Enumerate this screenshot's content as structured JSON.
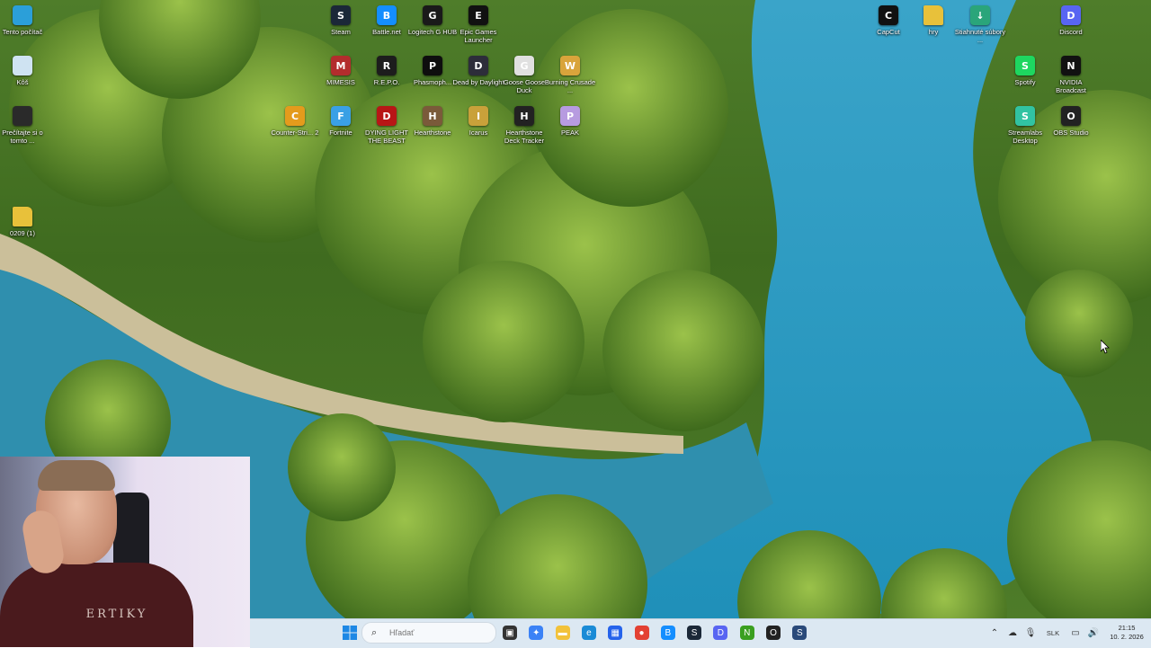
{
  "desktop": {
    "left_column": [
      {
        "label": "Tento počítač",
        "icon": "monitor-icon",
        "color": "#2b9fd9"
      },
      {
        "label": "Kôš",
        "icon": "recycle-bin-icon",
        "color": "#cfe3f2"
      },
      {
        "label": "Prečítajte si o tomto ...",
        "icon": "info-icon",
        "color": "#2a2a2a"
      },
      {
        "label": "0209 (1)",
        "icon": "folder-icon",
        "color": "#e8c13a"
      }
    ],
    "row1": [
      {
        "label": "Steam",
        "icon": "steam-icon",
        "color": "#1b2838",
        "glyph": "S"
      },
      {
        "label": "Battle.net",
        "icon": "battlenet-icon",
        "color": "#148eff",
        "glyph": "B"
      },
      {
        "label": "Logitech G HUB",
        "icon": "logitech-icon",
        "color": "#1a1a1a",
        "glyph": "G"
      },
      {
        "label": "Epic Games Launcher",
        "icon": "epic-games-icon",
        "color": "#111111",
        "glyph": "E"
      }
    ],
    "row2": [
      {
        "label": "MIMESIS",
        "icon": "mimesis-icon",
        "color": "#b32d2d",
        "glyph": "M"
      },
      {
        "label": "R.E.P.O.",
        "icon": "repo-icon",
        "color": "#1d1d1d",
        "glyph": "R"
      },
      {
        "label": "Phasmoph...",
        "icon": "phasmophobia-icon",
        "color": "#0e0e0e",
        "glyph": "P"
      },
      {
        "label": "Dead by Daylight",
        "icon": "dead-by-daylight-icon",
        "color": "#2d2d3a",
        "glyph": "D"
      },
      {
        "label": "Goose Goose Duck",
        "icon": "goose-goose-duck-icon",
        "color": "#e0e0e0",
        "glyph": "G"
      },
      {
        "label": "Burning Crusade ...",
        "icon": "wow-icon",
        "color": "#d9a43b",
        "glyph": "W"
      }
    ],
    "row3": [
      {
        "label": "Counter-Stri... 2",
        "icon": "counter-strike-icon",
        "color": "#e49b1c",
        "glyph": "C"
      },
      {
        "label": "Fortnite",
        "icon": "fortnite-icon",
        "color": "#3aa0e5",
        "glyph": "F"
      },
      {
        "label": "DYING LIGHT THE BEAST",
        "icon": "dying-light-icon",
        "color": "#b81616",
        "glyph": "D"
      },
      {
        "label": "Hearthstone",
        "icon": "hearthstone-icon",
        "color": "#7a5a3a",
        "glyph": "H"
      },
      {
        "label": "Icarus",
        "icon": "icarus-icon",
        "color": "#c9a13a",
        "glyph": "I"
      },
      {
        "label": "Hearthstone Deck Tracker",
        "icon": "deck-tracker-icon",
        "color": "#222222",
        "glyph": "H"
      },
      {
        "label": "PEAK",
        "icon": "peak-icon",
        "color": "#b79be0",
        "glyph": "P"
      }
    ],
    "right_top": [
      {
        "label": "CapCut",
        "icon": "capcut-icon",
        "color": "#111111",
        "glyph": "C"
      },
      {
        "label": "hry",
        "icon": "folder-icon",
        "color": "#e8c13a",
        "glyph": ""
      },
      {
        "label": "Stiahnuté súbory ...",
        "icon": "downloads-icon",
        "color": "#2aa57a",
        "glyph": "↓"
      },
      {
        "label": "Discord",
        "icon": "discord-icon",
        "color": "#5865f2",
        "glyph": "D"
      }
    ],
    "right_mid": [
      {
        "label": "Spotify",
        "icon": "spotify-icon",
        "color": "#1ed760",
        "glyph": "S"
      },
      {
        "label": "NVIDIA Broadcast",
        "icon": "nvidia-broadcast-icon",
        "color": "#111111",
        "glyph": "N"
      }
    ],
    "right_bottom": [
      {
        "label": "Streamlabs Desktop",
        "icon": "streamlabs-icon",
        "color": "#31c3a2",
        "glyph": "S"
      },
      {
        "label": "OBS Studio",
        "icon": "obs-icon",
        "color": "#222222",
        "glyph": "O"
      }
    ]
  },
  "webcam": {
    "shirt_text": "ERTIKY"
  },
  "taskbar": {
    "search_placeholder": "Hľadať",
    "pinned": [
      {
        "name": "task-view-icon",
        "color": "#333333",
        "glyph": "▣"
      },
      {
        "name": "copilot-icon",
        "color": "#3b82f6",
        "glyph": "✦"
      },
      {
        "name": "file-explorer-icon",
        "color": "#f2c23a",
        "glyph": "▬"
      },
      {
        "name": "edge-icon",
        "color": "#1a8bd6",
        "glyph": "e"
      },
      {
        "name": "store-icon",
        "color": "#2563eb",
        "glyph": "▦"
      },
      {
        "name": "chrome-icon",
        "color": "#e34133",
        "glyph": "●"
      },
      {
        "name": "battlenet-taskbar-icon",
        "color": "#148eff",
        "glyph": "B"
      },
      {
        "name": "steam-taskbar-icon",
        "color": "#1b2838",
        "glyph": "S"
      },
      {
        "name": "discord-taskbar-icon",
        "color": "#5865f2",
        "glyph": "D"
      },
      {
        "name": "nvidia-taskbar-icon",
        "color": "#3a9f1f",
        "glyph": "N"
      },
      {
        "name": "obs-taskbar-icon",
        "color": "#222222",
        "glyph": "O"
      },
      {
        "name": "steam-taskbar-icon-2",
        "color": "#2a4a7a",
        "glyph": "S"
      }
    ],
    "tray": {
      "language": "SLK",
      "time": "21:15",
      "date": "10. 2. 2026"
    }
  }
}
